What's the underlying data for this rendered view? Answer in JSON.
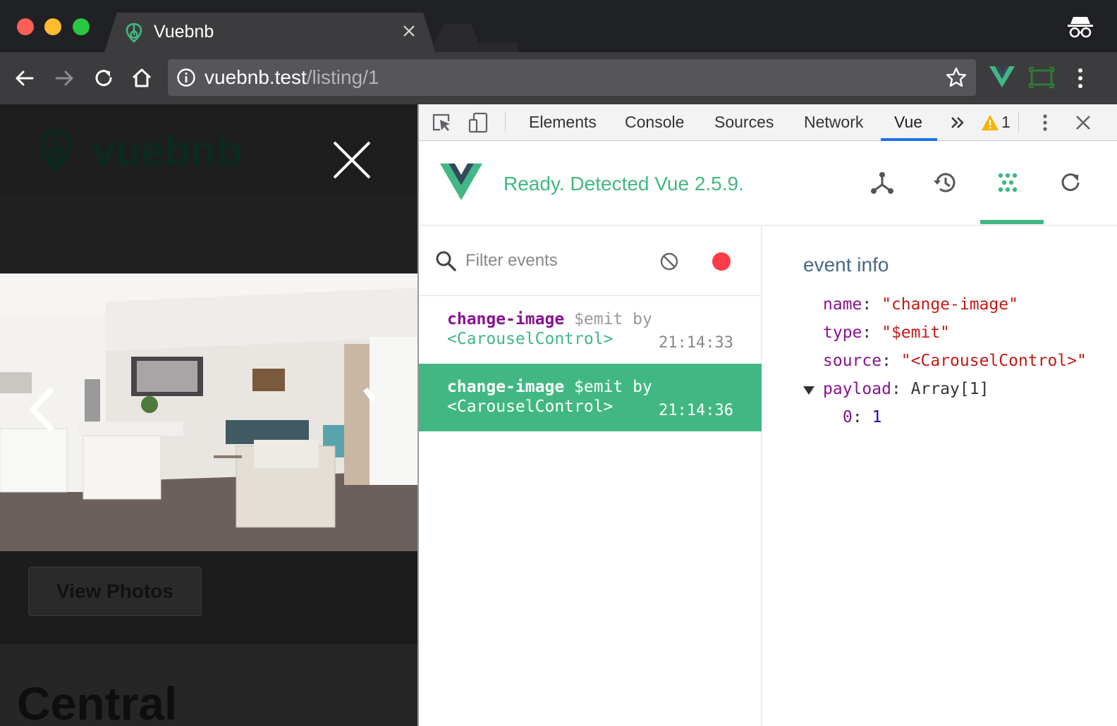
{
  "browser": {
    "tab_title": "Vuebnb",
    "url_host": "vuebnb.test",
    "url_path": "/listing/1"
  },
  "page": {
    "brand": "vuebnb",
    "view_photos_label": "View Photos",
    "heading_partial": "Central"
  },
  "devtools": {
    "tabs": [
      "Elements",
      "Console",
      "Sources",
      "Network",
      "Vue"
    ],
    "active_tab": "Vue",
    "warning_count": "1",
    "vue": {
      "status": "Ready. Detected Vue 2.5.9.",
      "active_tool": "events",
      "filter_placeholder": "Filter events",
      "events": [
        {
          "name": "change-image",
          "kind": "$emit",
          "by": "by",
          "component": "<CarouselControl>",
          "time": "21:14:33",
          "selected": false
        },
        {
          "name": "change-image",
          "kind": "$emit",
          "by": "by",
          "component": "<CarouselControl>",
          "time": "21:14:36",
          "selected": true
        }
      ],
      "event_info": {
        "title": "event info",
        "name_key": "name",
        "name_value": "\"change-image\"",
        "type_key": "type",
        "type_value": "\"$emit\"",
        "source_key": "source",
        "source_value": "\"<CarouselControl>\"",
        "payload_key": "payload",
        "payload_value": "Array[1]",
        "payload_index": "0",
        "payload_item": "1"
      }
    }
  },
  "colors": {
    "vue_green": "#41b883",
    "vue_dark": "#35495e",
    "chrome_dark": "#202124",
    "chrome_toolbar": "#3c3c3e",
    "key_purple": "#881391",
    "string_red": "#c41a16",
    "number_blue": "#1c00cf",
    "record_red": "#ff3b47",
    "active_tab_blue": "#1a73e8"
  }
}
